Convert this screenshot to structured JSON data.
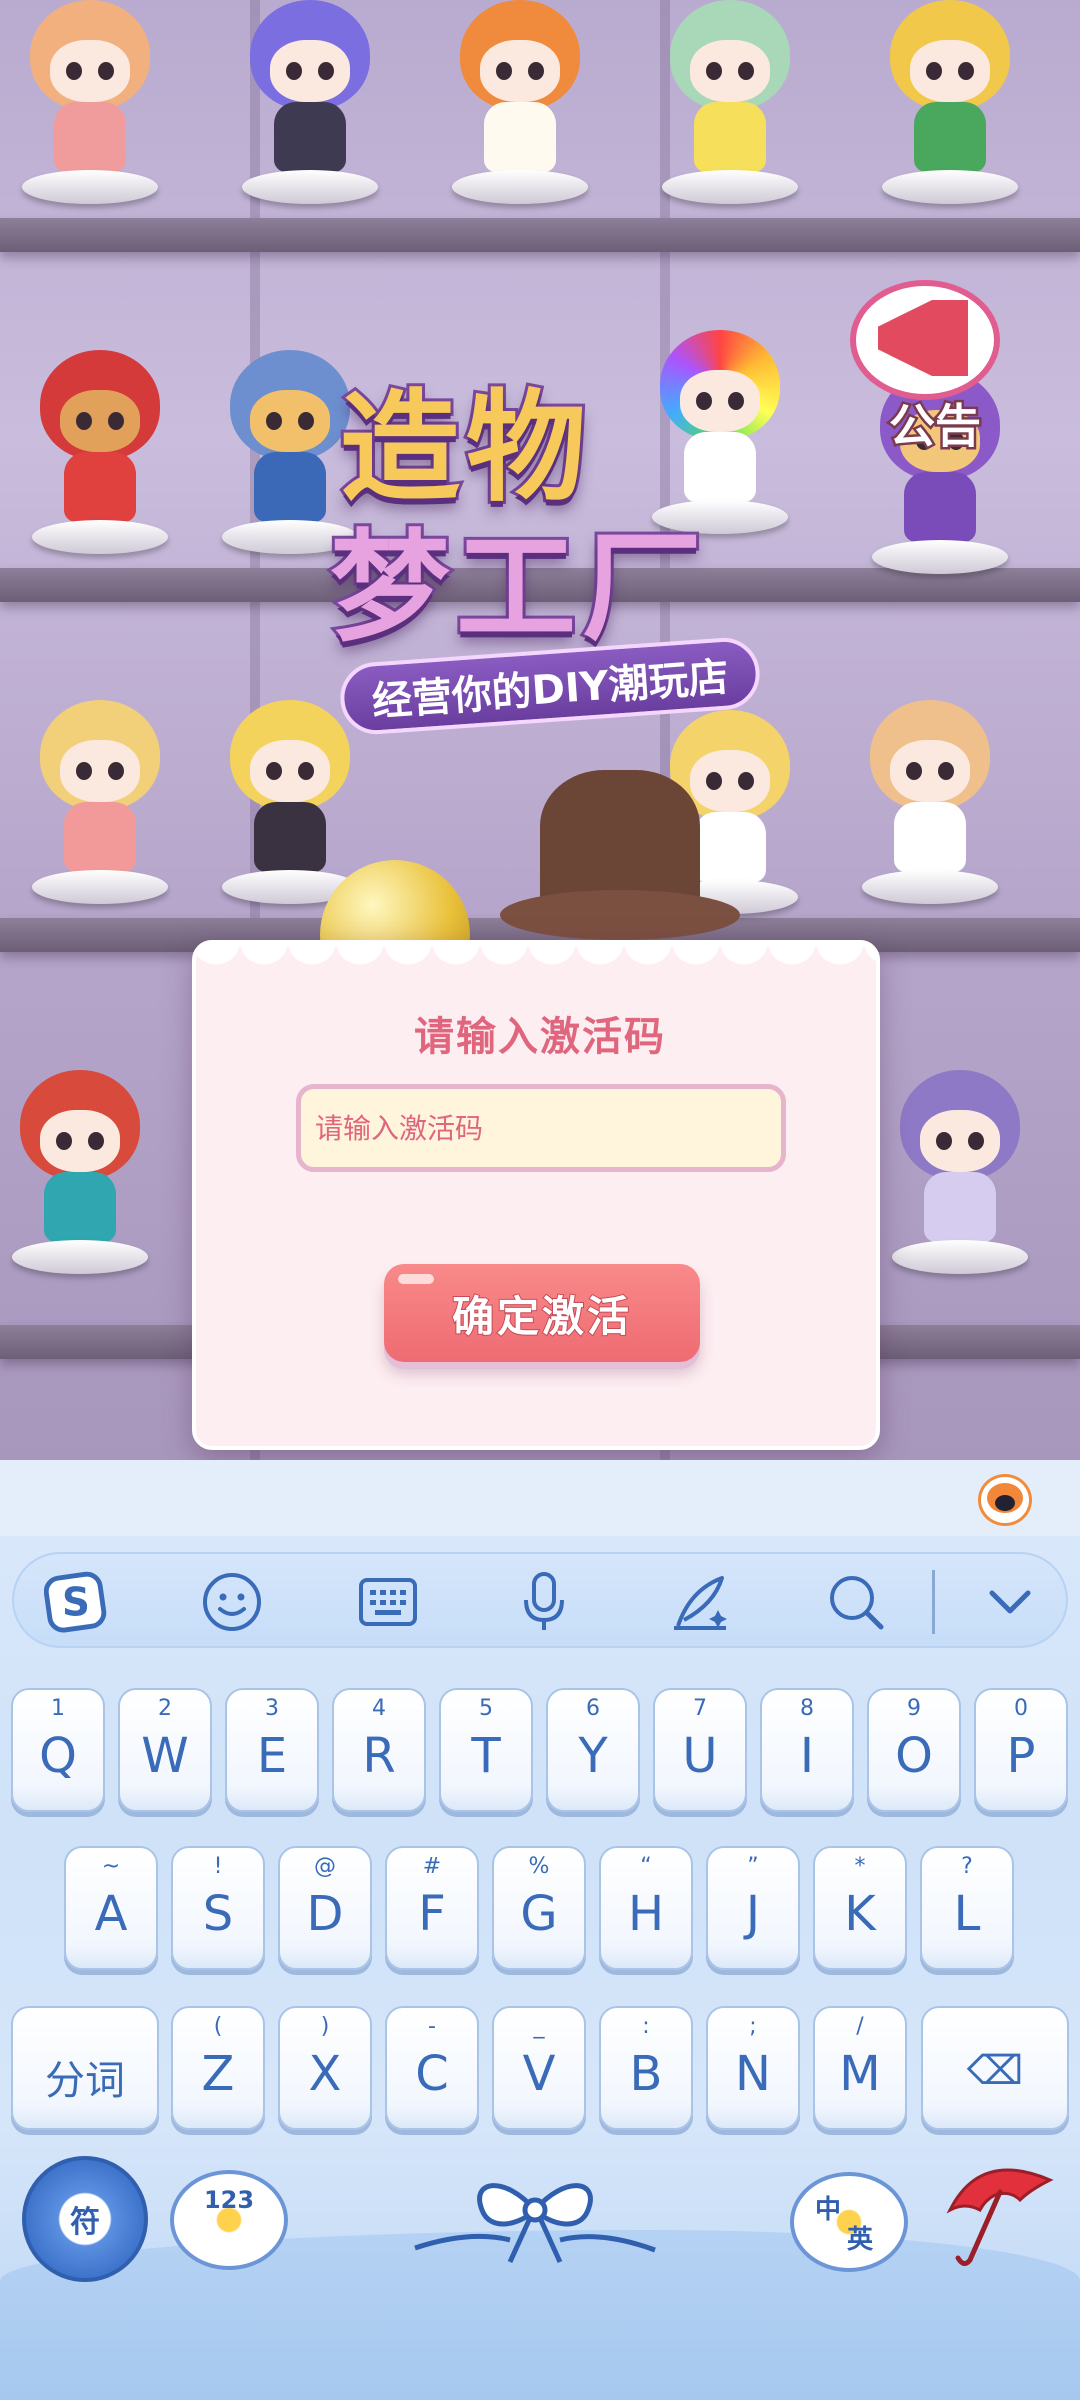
{
  "background": {
    "logo_line1": "造物",
    "logo_line2": "梦工厂",
    "tagline": "经营你的DIY潮玩店",
    "announcement_label": "公告"
  },
  "dialog": {
    "title": "请输入激活码",
    "input_placeholder": "请输入激活码",
    "input_value": "",
    "confirm_label": "确定激活"
  },
  "keyboard": {
    "toolbar": [
      "sogou-logo-icon",
      "emoji-icon",
      "keyboard-icon",
      "microphone-icon",
      "handwriting-icon",
      "search-icon",
      "collapse-chevron-icon"
    ],
    "row1": [
      {
        "main": "Q",
        "sub": "1"
      },
      {
        "main": "W",
        "sub": "2"
      },
      {
        "main": "E",
        "sub": "3"
      },
      {
        "main": "R",
        "sub": "4"
      },
      {
        "main": "T",
        "sub": "5"
      },
      {
        "main": "Y",
        "sub": "6"
      },
      {
        "main": "U",
        "sub": "7"
      },
      {
        "main": "I",
        "sub": "8"
      },
      {
        "main": "O",
        "sub": "9"
      },
      {
        "main": "P",
        "sub": "0"
      }
    ],
    "row2": [
      {
        "main": "A",
        "sub": "~"
      },
      {
        "main": "S",
        "sub": "!"
      },
      {
        "main": "D",
        "sub": "@"
      },
      {
        "main": "F",
        "sub": "#"
      },
      {
        "main": "G",
        "sub": "%"
      },
      {
        "main": "H",
        "sub": "“"
      },
      {
        "main": "J",
        "sub": "”"
      },
      {
        "main": "K",
        "sub": "*"
      },
      {
        "main": "L",
        "sub": "?"
      }
    ],
    "row3": [
      {
        "main": "分词",
        "sub": ""
      },
      {
        "main": "Z",
        "sub": "("
      },
      {
        "main": "X",
        "sub": ")"
      },
      {
        "main": "C",
        "sub": "-"
      },
      {
        "main": "V",
        "sub": "_"
      },
      {
        "main": "B",
        "sub": ":"
      },
      {
        "main": "N",
        "sub": ";"
      },
      {
        "main": "M",
        "sub": "/"
      },
      {
        "main": "⌫",
        "sub": ""
      }
    ],
    "bottom": {
      "symbol_label": "符",
      "numbers_label": "123",
      "lang_label_1": "中",
      "lang_label_2": "英"
    }
  }
}
